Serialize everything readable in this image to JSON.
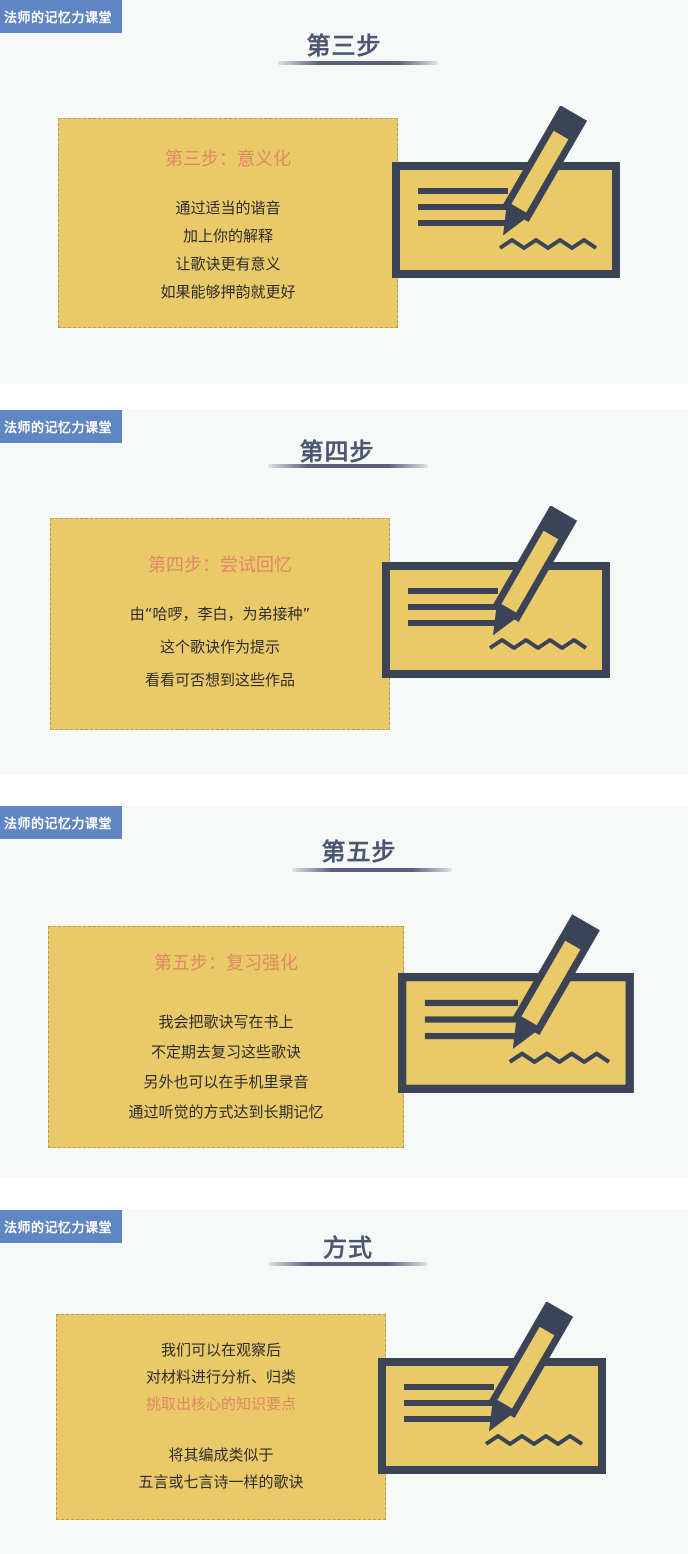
{
  "brand_badge": "法师的记忆力课堂",
  "slides": [
    {
      "title": "第三步",
      "card_heading": "第三步：意义化",
      "lines": [
        "通过适当的谐音",
        "加上你的解释",
        "让歌诀更有意义",
        "如果能够押韵就更好"
      ]
    },
    {
      "title": "第四步",
      "card_heading": "第四步：尝试回忆",
      "lines": [
        "由“哈啰，李白，为弟接种”",
        "这个歌诀作为提示",
        "看看可否想到这些作品"
      ]
    },
    {
      "title": "第五步",
      "card_heading": "第五步：复习强化",
      "lines": [
        "我会把歌诀写在书上",
        "不定期去复习这些歌诀",
        "另外也可以在手机里录音",
        "通过听觉的方式达到长期记忆"
      ]
    },
    {
      "title": "方式",
      "lines": [
        "我们可以在观察后",
        "对材料进行分析、归类",
        "挑取出核心的知识要点",
        "将其编成类似于",
        "五言或七言诗一样的歌诀"
      ]
    }
  ],
  "colors": {
    "badge_bg": "#5f86c3",
    "card_bg": "#eac969",
    "accent_text": "#e08866",
    "title_text": "#4c5670",
    "art_dark": "#3a4456"
  },
  "icons": [
    "pen-writing-on-card-icon"
  ]
}
